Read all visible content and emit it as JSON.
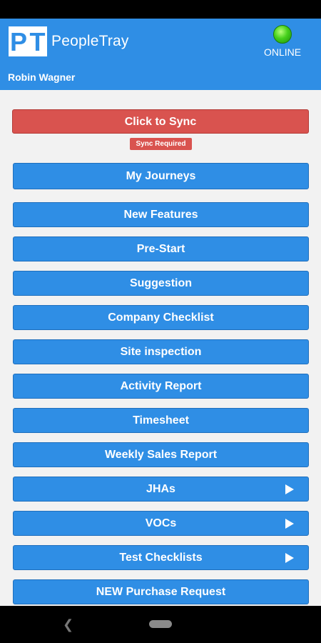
{
  "header": {
    "logo_letters": "PT",
    "app_name": "PeopleTray",
    "status": "ONLINE",
    "user_name": "Robin Wagner"
  },
  "sync": {
    "button_label": "Click to Sync",
    "badge": "Sync Required"
  },
  "menu": {
    "items": [
      {
        "label": "My Journeys",
        "has_arrow": false
      },
      {
        "label": "New Features",
        "has_arrow": false
      },
      {
        "label": "Pre-Start",
        "has_arrow": false
      },
      {
        "label": "Suggestion",
        "has_arrow": false
      },
      {
        "label": "Company Checklist",
        "has_arrow": false
      },
      {
        "label": "Site inspection",
        "has_arrow": false
      },
      {
        "label": "Activity Report",
        "has_arrow": false
      },
      {
        "label": "Timesheet",
        "has_arrow": false
      },
      {
        "label": "Weekly Sales Report",
        "has_arrow": false
      },
      {
        "label": "JHAs",
        "has_arrow": true
      },
      {
        "label": "VOCs",
        "has_arrow": true
      },
      {
        "label": "Test Checklists",
        "has_arrow": true
      },
      {
        "label": "NEW Purchase Request",
        "has_arrow": false
      }
    ]
  },
  "nav": {
    "back_icon": "back-icon",
    "home_icon": "home-pill-icon"
  },
  "colors": {
    "primary": "#2f8ee5",
    "danger": "#d9534f",
    "online": "#46d11c"
  }
}
